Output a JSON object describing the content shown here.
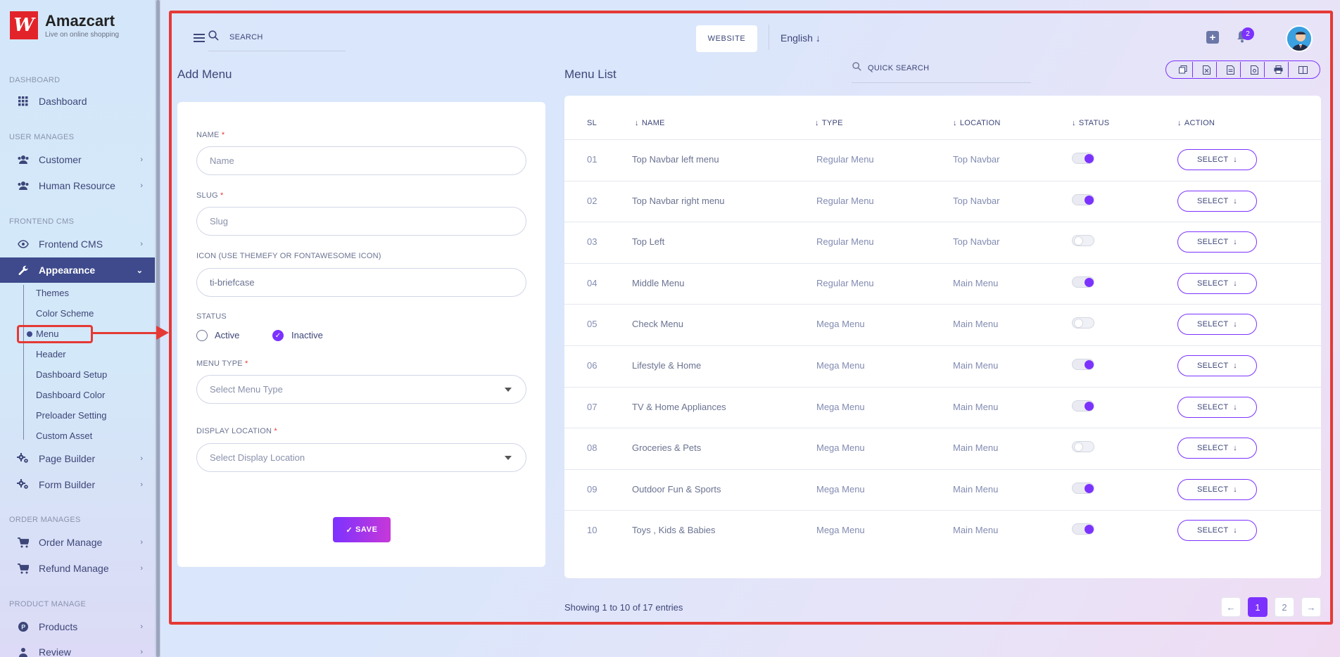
{
  "brand": {
    "name": "Amazcart",
    "tagline": "Live on online shopping",
    "logo_glyph": "W"
  },
  "sidebar": {
    "sections": [
      {
        "label": "DASHBOARD"
      },
      {
        "label": "USER MANAGES"
      },
      {
        "label": "FRONTEND CMS"
      },
      {
        "label": "ORDER MANAGES"
      },
      {
        "label": "PRODUCT MANAGE"
      }
    ],
    "items": [
      {
        "label": "Dashboard",
        "icon": "grid-icon"
      },
      {
        "label": "Customer",
        "icon": "users-icon"
      },
      {
        "label": "Human Resource",
        "icon": "users-icon"
      },
      {
        "label": "Frontend CMS",
        "icon": "eye-icon"
      },
      {
        "label": "Appearance",
        "icon": "wrench-icon"
      },
      {
        "label": "Page Builder",
        "icon": "gears-icon"
      },
      {
        "label": "Form Builder",
        "icon": "gears-icon"
      },
      {
        "label": "Order Manage",
        "icon": "cart-icon"
      },
      {
        "label": "Refund Manage",
        "icon": "cart-icon"
      },
      {
        "label": "Products",
        "icon": "product-icon"
      },
      {
        "label": "Review",
        "icon": "user-icon"
      }
    ],
    "appearance_sub": [
      "Themes",
      "Color Scheme",
      "Menu",
      "Header",
      "Dashboard Setup",
      "Dashboard Color",
      "Preloader Setting",
      "Custom Asset"
    ]
  },
  "topbar": {
    "search_label": "SEARCH",
    "website_label": "WEBSITE",
    "language": "English",
    "notification_count": "2"
  },
  "add_menu": {
    "title": "Add Menu",
    "name_label": "NAME",
    "name_placeholder": "Name",
    "slug_label": "SLUG",
    "slug_placeholder": "Slug",
    "icon_label": "ICON (USE THEMEFY OR FONTAWESOME ICON)",
    "icon_value": "ti-briefcase",
    "status_label": "STATUS",
    "status_active": "Active",
    "status_inactive": "Inactive",
    "menu_type_label": "MENU TYPE",
    "menu_type_placeholder": "Select Menu Type",
    "display_location_label": "DISPLAY LOCATION",
    "display_location_placeholder": "Select Display Location",
    "required_mark": "*",
    "save_label": "SAVE"
  },
  "menu_list": {
    "title": "Menu List",
    "quick_search": "QUICK SEARCH",
    "export_buttons": [
      "copy-icon",
      "excel-icon",
      "csv-icon",
      "pdf-icon",
      "print-icon",
      "columns-icon"
    ],
    "headers": {
      "sl": "SL",
      "name": "NAME",
      "type": "TYPE",
      "location": "LOCATION",
      "status": "STATUS",
      "action": "ACTION"
    },
    "select_label": "SELECT",
    "rows": [
      {
        "sl": "01",
        "name": "Top Navbar left menu",
        "type": "Regular Menu",
        "location": "Top Navbar",
        "status": true
      },
      {
        "sl": "02",
        "name": "Top Navbar right menu",
        "type": "Regular Menu",
        "location": "Top Navbar",
        "status": true
      },
      {
        "sl": "03",
        "name": "Top Left",
        "type": "Regular Menu",
        "location": "Top Navbar",
        "status": false
      },
      {
        "sl": "04",
        "name": "Middle Menu",
        "type": "Regular Menu",
        "location": "Main Menu",
        "status": true
      },
      {
        "sl": "05",
        "name": "Check Menu",
        "type": "Mega Menu",
        "location": "Main Menu",
        "status": false
      },
      {
        "sl": "06",
        "name": "Lifestyle & Home",
        "type": "Mega Menu",
        "location": "Main Menu",
        "status": true
      },
      {
        "sl": "07",
        "name": "TV & Home Appliances",
        "type": "Mega Menu",
        "location": "Main Menu",
        "status": true
      },
      {
        "sl": "08",
        "name": "Groceries & Pets",
        "type": "Mega Menu",
        "location": "Main Menu",
        "status": false
      },
      {
        "sl": "09",
        "name": "Outdoor Fun & Sports",
        "type": "Mega Menu",
        "location": "Main Menu",
        "status": true
      },
      {
        "sl": "10",
        "name": "Toys , Kids & Babies",
        "type": "Mega Menu",
        "location": "Main Menu",
        "status": true
      }
    ],
    "showing": "Showing 1 to 10 of 17 entries",
    "pages": [
      "1",
      "2"
    ],
    "current_page": "1"
  },
  "colors": {
    "accent": "#7c32ff",
    "sidebar_active": "#3e4a8c",
    "highlight": "#e53935",
    "text": "#415094"
  }
}
